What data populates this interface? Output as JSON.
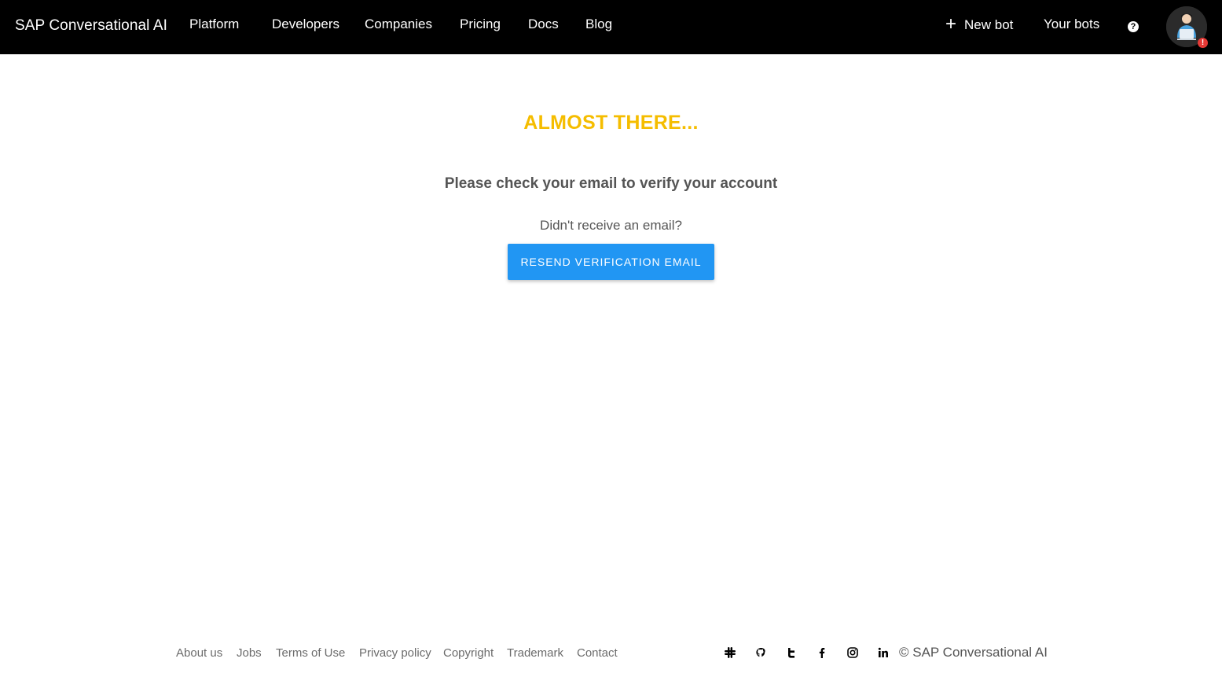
{
  "header": {
    "brand": "SAP Conversational AI",
    "nav": {
      "platform": "Platform",
      "developers": "Developers",
      "companies": "Companies",
      "pricing": "Pricing",
      "docs": "Docs",
      "blog": "Blog"
    },
    "new_bot_icon": "plus-icon",
    "new_bot": "New bot",
    "your_bots": "Your bots",
    "help_icon": "question-circle-icon",
    "help_glyph": "?",
    "avatar_icon": "user-avatar-icon",
    "alert_glyph": "!"
  },
  "main": {
    "title": "ALMOST THERE...",
    "subtitle": "Please check your email to verify your account",
    "question": "Didn't receive an email?",
    "resend_button": "RESEND VERIFICATION EMAIL"
  },
  "footer": {
    "links": {
      "about": "About us",
      "jobs": "Jobs",
      "terms": "Terms of Use",
      "privacy": "Privacy policy",
      "copyright": "Copyright",
      "trademark": "Trademark",
      "contact": "Contact"
    },
    "social_icons": [
      "slack-icon",
      "github-icon",
      "twitter-icon",
      "facebook-icon",
      "instagram-icon",
      "linkedin-icon"
    ],
    "copyright_text": "© SAP Conversational AI"
  },
  "colors": {
    "header_bg": "#000000",
    "title": "#f5bd00",
    "button": "#2196f3",
    "text": "#555555",
    "alert": "#e53935"
  }
}
